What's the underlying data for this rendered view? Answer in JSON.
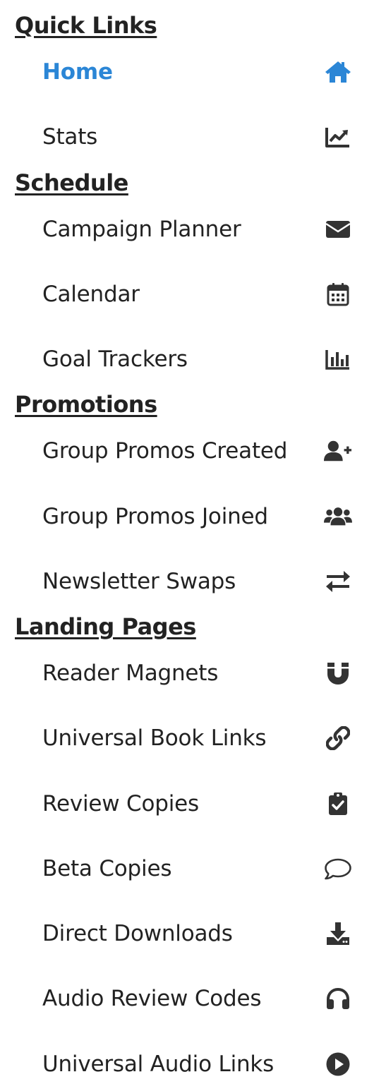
{
  "colors": {
    "active": "#2b86d6",
    "text": "#222222",
    "icon": "#333333"
  },
  "sections": [
    {
      "heading": "Quick Links",
      "items": [
        {
          "label": "Home",
          "icon": "home-icon",
          "active": true
        },
        {
          "label": "Stats",
          "icon": "chart-line-icon"
        }
      ]
    },
    {
      "heading": "Schedule",
      "items": [
        {
          "label": "Campaign Planner",
          "icon": "envelope-icon"
        },
        {
          "label": "Calendar",
          "icon": "calendar-icon"
        },
        {
          "label": "Goal Trackers",
          "icon": "bar-chart-icon"
        }
      ]
    },
    {
      "heading": "Promotions",
      "items": [
        {
          "label": "Group Promos Created",
          "icon": "user-plus-icon"
        },
        {
          "label": "Group Promos Joined",
          "icon": "users-icon"
        },
        {
          "label": "Newsletter Swaps",
          "icon": "exchange-arrows-icon"
        }
      ]
    },
    {
      "heading": "Landing Pages",
      "items": [
        {
          "label": "Reader Magnets",
          "icon": "magnet-icon"
        },
        {
          "label": "Universal Book Links",
          "icon": "link-icon"
        },
        {
          "label": "Review Copies",
          "icon": "clipboard-check-icon"
        },
        {
          "label": "Beta Copies",
          "icon": "comment-icon"
        },
        {
          "label": "Direct Downloads",
          "icon": "download-icon"
        },
        {
          "label": "Audio Review Codes",
          "icon": "headphones-icon"
        },
        {
          "label": "Universal Audio Links",
          "icon": "play-circle-icon"
        }
      ]
    }
  ]
}
